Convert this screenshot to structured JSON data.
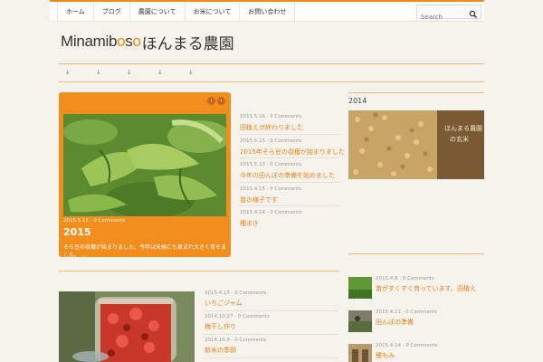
{
  "topnav": {
    "items": [
      "ホーム",
      "ブログ",
      "農園について",
      "お米について",
      "お問い合わせ"
    ],
    "search_placeholder": "Search"
  },
  "logo": {
    "latin_pre": "Minamib",
    "latin_o1": "o",
    "latin_mid": "s",
    "latin_o2": "o",
    "jp": "ほんまる農園"
  },
  "subnav": [
    "↓",
    "↓",
    "↓",
    "↓",
    "↓"
  ],
  "feature": {
    "meta": "2015.5.15  ·  0 Comments",
    "title": "2015",
    "excerpt": "そら豆の収穫が始まりました。今年は天候にも恵まれ大きく育ちました。 ..."
  },
  "recent_posts": [
    {
      "meta": "2015.5.16  ·  0 Comments",
      "title": "田植えが終わりました"
    },
    {
      "meta": "2015.5.15  ·  0 Comments",
      "title": "2015年そら豆の収穫が始まりました"
    },
    {
      "meta": "2015.5.13  ·  0 Comments",
      "title": "今年の田んぼの準備を始めました"
    },
    {
      "meta": "2015.4.15  ·  0 Comments",
      "title": "苗の様子です"
    },
    {
      "meta": "2015.4.14  ·  0 Comments",
      "title": "種まき"
    }
  ],
  "sidebar": {
    "heading": "2014",
    "photo_caption_lines": [
      "ほんまる農園",
      "の玄米"
    ],
    "posts": [
      {
        "meta": "2015.4.8  ·  0 Comments",
        "title": "苗がすくすく育っています。田植え"
      },
      {
        "meta": "2015.4.11  ·  0 Comments",
        "title": "田んぼの準備"
      },
      {
        "meta": "2015.4.14  ·  0 Comments",
        "title": "種もみ"
      }
    ]
  },
  "bottom_posts": [
    {
      "meta": "2015.4.15  ·  0 Comments",
      "title": "いちごジャム"
    },
    {
      "meta": "2014.10.27  ·  0 Comments",
      "title": "梅干し作り"
    },
    {
      "meta": "2014.10.9  ·  0 Comments",
      "title": "新米の季節"
    }
  ],
  "colors": {
    "accent": "#f28e1e",
    "link": "#e7851a",
    "background": "#f6f3ec"
  },
  "icons": {
    "search": "search-icon",
    "prev": "chevron-left-icon",
    "next": "chevron-right-icon"
  }
}
